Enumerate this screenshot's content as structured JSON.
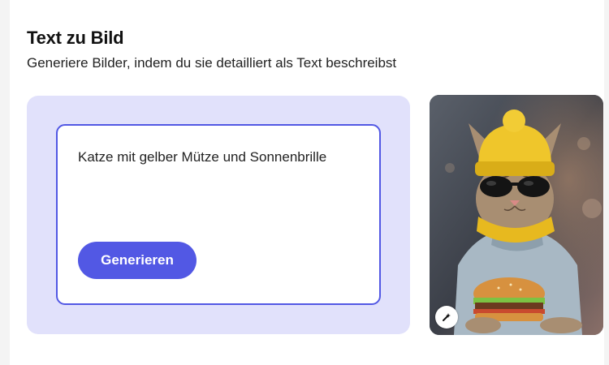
{
  "section": {
    "title": "Text zu Bild",
    "subtitle": "Generiere Bilder, indem du sie detailliert als Text beschreibst"
  },
  "prompt": {
    "text": "Katze mit gelber Mütze und Sonnenbrille",
    "button_label": "Generieren"
  },
  "image": {
    "badge_icon": "sparkle-icon"
  },
  "colors": {
    "accent": "#5258e4",
    "panel_bg": "#e1e1fb"
  }
}
